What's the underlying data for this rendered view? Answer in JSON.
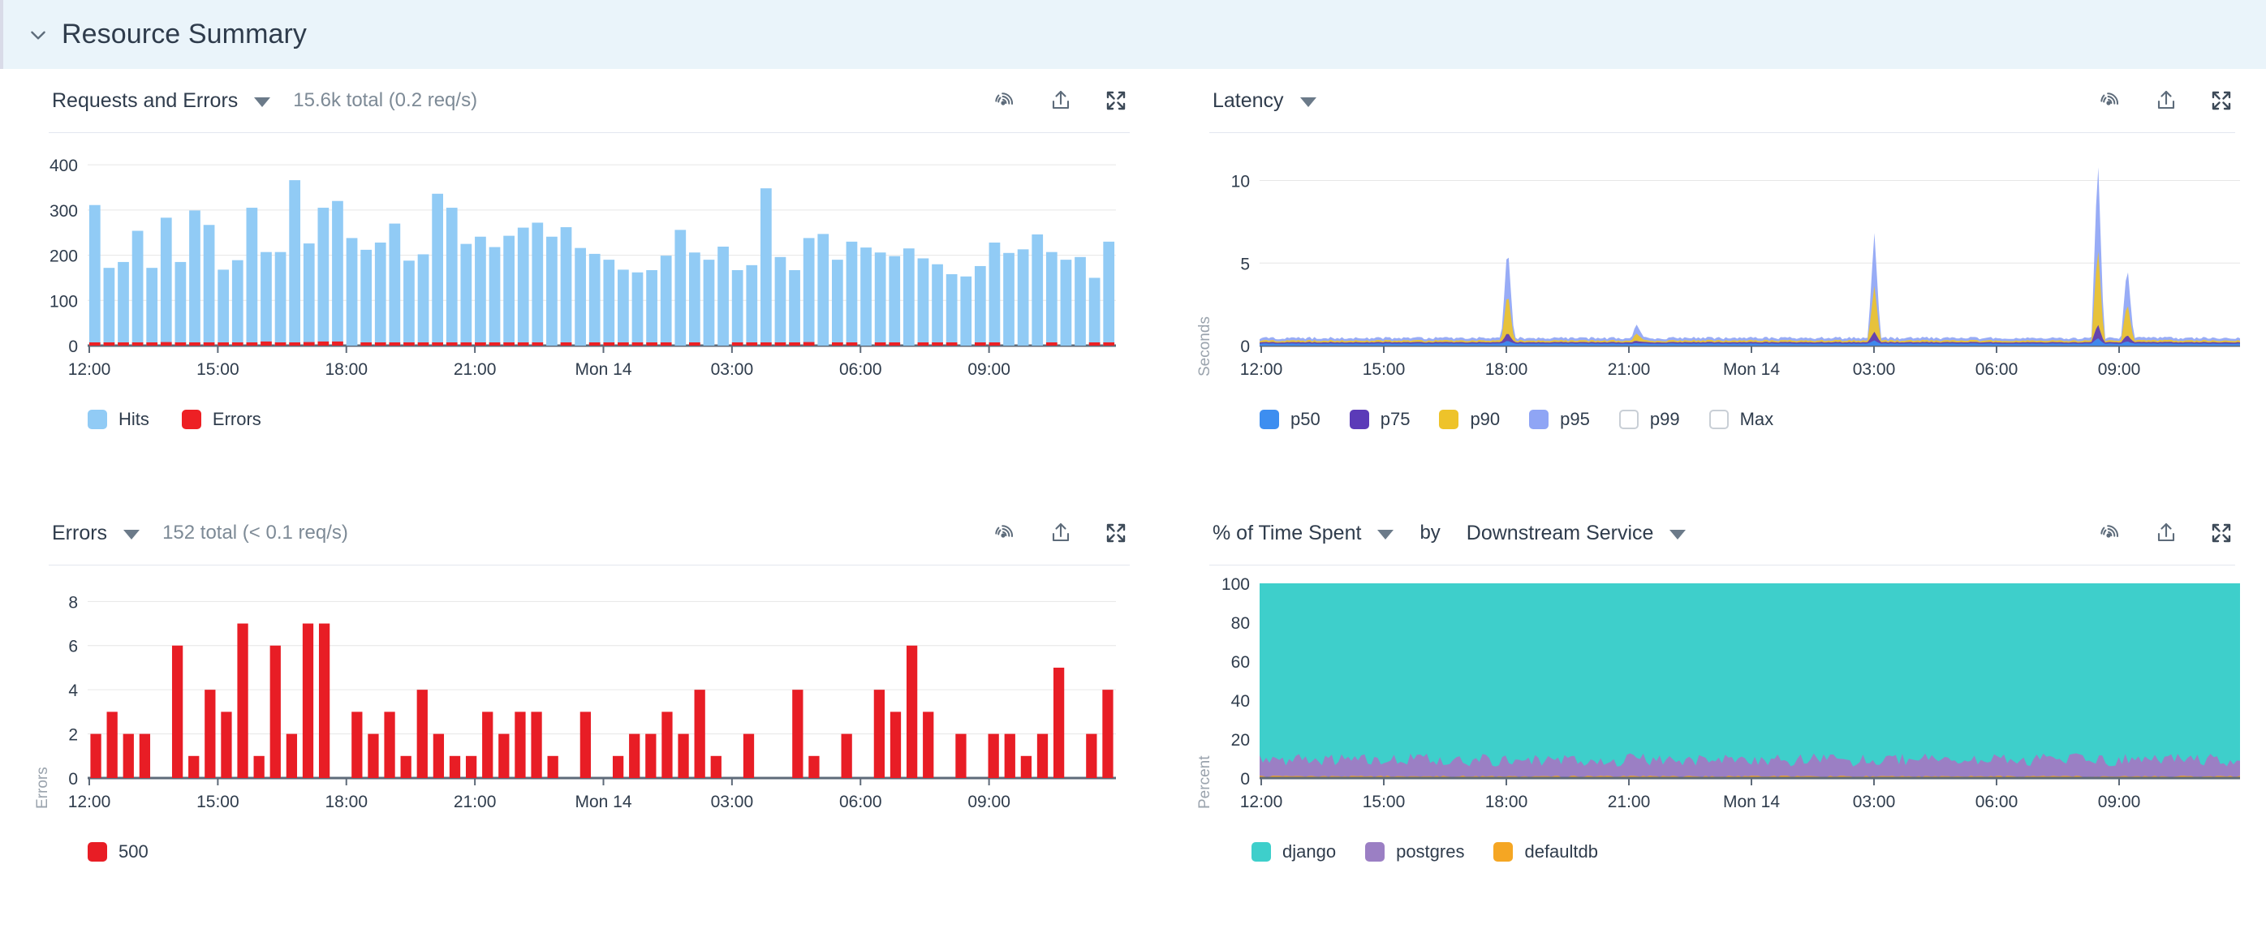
{
  "section": {
    "title": "Resource Summary",
    "collapse_icon": "chevron-down-icon",
    "expanded": true,
    "header_bg": "#eaf4fa"
  },
  "panel_actions": [
    {
      "name": "monitor-icon",
      "label": "Create monitor"
    },
    {
      "name": "export-icon",
      "label": "Export"
    },
    {
      "name": "fullscreen-icon",
      "label": "Expand"
    }
  ],
  "panels": {
    "requests_and_errors": {
      "title": "Requests and Errors",
      "dropdown_icon": "caret-down-icon",
      "subtitle": "15.6k total (0.2 req/s)"
    },
    "latency": {
      "title": "Latency",
      "dropdown_icon": "caret-down-icon",
      "subtitle": ""
    },
    "errors": {
      "title": "Errors",
      "dropdown_icon": "caret-down-icon",
      "subtitle": "152 total (< 0.1 req/s)"
    },
    "time_spent": {
      "title": "% of Time Spent",
      "dropdown_icon": "caret-down-icon",
      "by_label": "by",
      "group_by": "Downstream Service",
      "group_by_icon": "caret-down-icon"
    }
  },
  "chart_data": [
    {
      "id": "requests-and-errors",
      "type": "bar",
      "stacked": true,
      "title": "Requests and Errors",
      "xlabel": "",
      "ylabel": "",
      "ylim": [
        0,
        420
      ],
      "yticks": [
        0,
        100,
        200,
        300,
        400
      ],
      "grid": true,
      "legend_position": "bottom",
      "xticks": [
        "12:00",
        "15:00",
        "18:00",
        "21:00",
        "Mon 14",
        "03:00",
        "06:00",
        "09:00"
      ],
      "xtick_positions": [
        0,
        9,
        18,
        27,
        36,
        45,
        54,
        63
      ],
      "series": [
        {
          "name": "Hits",
          "color": "#91cbf5",
          "values": [
            311,
            172,
            185,
            254,
            172,
            283,
            185,
            299,
            267,
            168,
            189,
            305,
            207,
            207,
            366,
            226,
            305,
            320,
            238,
            212,
            228,
            270,
            188,
            202,
            336,
            305,
            225,
            241,
            218,
            243,
            261,
            272,
            241,
            262,
            216,
            203,
            190,
            168,
            162,
            167,
            199,
            256,
            206,
            190,
            219,
            167,
            178,
            348,
            196,
            167,
            238,
            247,
            190,
            230,
            217,
            206,
            198,
            215,
            193,
            180,
            158,
            153,
            176,
            228,
            205,
            213,
            246,
            207,
            190,
            196,
            150,
            230
          ]
        },
        {
          "name": "Errors",
          "color": "#ed2024",
          "values": [
            4,
            2,
            2,
            2,
            2,
            6,
            3,
            3,
            2,
            1,
            4,
            3,
            7,
            1,
            2,
            6,
            7,
            7,
            0,
            3,
            2,
            3,
            1,
            4,
            2,
            1,
            1,
            3,
            2,
            3,
            3,
            1,
            0,
            3,
            0,
            2,
            2,
            3,
            2,
            4,
            1,
            0,
            4,
            0,
            0,
            2,
            1,
            4,
            2,
            3,
            6,
            0,
            3,
            2,
            0,
            1,
            2,
            0,
            2,
            2,
            5,
            0,
            2,
            4,
            0,
            0,
            0,
            1,
            0,
            0,
            1,
            2
          ]
        }
      ]
    },
    {
      "id": "latency",
      "type": "area",
      "title": "Latency",
      "xlabel": "",
      "ylabel": "Seconds",
      "ylim": [
        0,
        11.5
      ],
      "yticks": [
        0,
        5,
        10
      ],
      "grid": true,
      "legend_position": "bottom",
      "xticks": [
        "12:00",
        "15:00",
        "18:00",
        "21:00",
        "Mon 14",
        "03:00",
        "06:00",
        "09:00"
      ],
      "legend_entries": [
        {
          "name": "p50",
          "color": "#3d8ef0",
          "enabled": true
        },
        {
          "name": "p75",
          "color": "#5b3bb8",
          "enabled": true
        },
        {
          "name": "p90",
          "color": "#eec32a",
          "enabled": true
        },
        {
          "name": "p95",
          "color": "#8fa5f5",
          "enabled": true
        },
        {
          "name": "p99",
          "color": "#ffffff",
          "enabled": false
        },
        {
          "name": "Max",
          "color": "#ffffff",
          "enabled": false
        }
      ],
      "spikes": [
        {
          "at": "18:20",
          "series": "p95",
          "value": 5.8
        },
        {
          "at": "20:10",
          "series": "p95",
          "value": 0.9
        },
        {
          "at": "03:05",
          "series": "p95",
          "value": 6.4
        },
        {
          "at": "08:30",
          "series": "p95",
          "value": 11.1
        },
        {
          "at": "08:55",
          "series": "p95",
          "value": 4.5
        }
      ],
      "baseline": {
        "p50": 0.12,
        "p75": 0.2,
        "p90": 0.3,
        "p95": 0.45
      }
    },
    {
      "id": "errors",
      "type": "bar",
      "title": "Errors",
      "xlabel": "",
      "ylabel": "Errors",
      "ylim": [
        0,
        8.6
      ],
      "yticks": [
        0,
        2,
        4,
        6,
        8
      ],
      "grid": true,
      "legend_position": "bottom",
      "xticks": [
        "12:00",
        "15:00",
        "18:00",
        "21:00",
        "Mon 14",
        "03:00",
        "06:00",
        "09:00"
      ],
      "series": [
        {
          "name": "500",
          "color": "#e81d25",
          "values": [
            2,
            3,
            2,
            2,
            0,
            6,
            1,
            4,
            3,
            7,
            1,
            6,
            2,
            7,
            7,
            0,
            3,
            2,
            3,
            1,
            4,
            2,
            1,
            1,
            3,
            2,
            3,
            3,
            1,
            0,
            3,
            0,
            1,
            2,
            2,
            3,
            2,
            4,
            1,
            0,
            2,
            0,
            0,
            4,
            1,
            0,
            2,
            0,
            4,
            3,
            6,
            3,
            0,
            2,
            0,
            2,
            2,
            1,
            2,
            5,
            0,
            2,
            4
          ]
        }
      ]
    },
    {
      "id": "time-spent",
      "type": "area",
      "stacked": true,
      "title": "% of Time Spent by Downstream Service",
      "xlabel": "",
      "ylabel": "Percent",
      "ylim": [
        0,
        100
      ],
      "yticks": [
        0,
        20,
        40,
        60,
        80,
        100
      ],
      "grid": false,
      "legend_position": "bottom",
      "xticks": [
        "12:00",
        "15:00",
        "18:00",
        "21:00",
        "Mon 14",
        "03:00",
        "06:00",
        "09:00"
      ],
      "series": [
        {
          "name": "django",
          "color": "#3ecfcb",
          "avg_percent": 89.5
        },
        {
          "name": "postgres",
          "color": "#9b7fc4",
          "avg_percent": 9.5
        },
        {
          "name": "defaultdb",
          "color": "#f5a623",
          "avg_percent": 1.0
        }
      ]
    }
  ]
}
